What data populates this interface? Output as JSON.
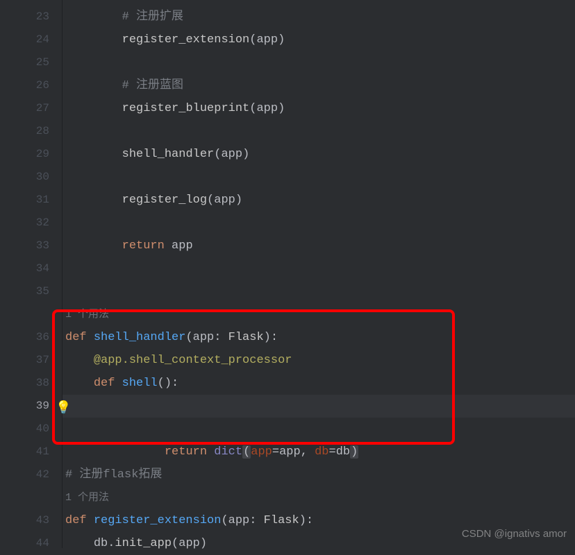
{
  "gutter": {
    "lines": [
      "23",
      "24",
      "25",
      "26",
      "27",
      "28",
      "29",
      "30",
      "31",
      "32",
      "33",
      "34",
      "35",
      "",
      "36",
      "37",
      "38",
      "39",
      "40",
      "41",
      "42",
      "",
      "43",
      "44"
    ],
    "current_index": 17
  },
  "hints": {
    "usage1": "1 个用法",
    "usage2": "1 个用法"
  },
  "code": {
    "l23": {
      "indent": "        ",
      "comment": "# 注册扩展"
    },
    "l24": {
      "indent": "        ",
      "fn": "register_extension",
      "arg": "app"
    },
    "l25": {
      "blank": true
    },
    "l26": {
      "indent": "        ",
      "comment": "# 注册蓝图"
    },
    "l27": {
      "indent": "        ",
      "fn": "register_blueprint",
      "arg": "app"
    },
    "l28": {
      "blank": true
    },
    "l29": {
      "indent": "        ",
      "fn": "shell_handler",
      "arg": "app"
    },
    "l30": {
      "blank": true
    },
    "l31": {
      "indent": "        ",
      "fn": "register_log",
      "arg": "app"
    },
    "l32": {
      "blank": true
    },
    "l33": {
      "indent": "        ",
      "kw": "return",
      "var": " app"
    },
    "l34": {
      "blank": true
    },
    "l35": {
      "blank": true
    },
    "l36": {
      "def": "def ",
      "name": "shell_handler",
      "sig_l": "(",
      "param": "app",
      "colon_t": ": ",
      "type": "Flask",
      "sig_r": "):"
    },
    "l37": {
      "indent": "    ",
      "dec_at": "@",
      "dec_obj": "app",
      "dec_dot": ".",
      "dec_fn": "shell_context_processor"
    },
    "l38": {
      "indent": "    ",
      "def": "def ",
      "name": "shell",
      "sig": "():"
    },
    "l39": {
      "indent": "        ",
      "kw": "return ",
      "builtin": "dict",
      "lp": "(",
      "k1": "app",
      "eq1": "=",
      "v1": "app",
      "comma": ", ",
      "k2": "db",
      "eq2": "=",
      "v2": "db",
      "rp": ")"
    },
    "l40": {
      "blank": true
    },
    "l41": {
      "blank": true
    },
    "l42": {
      "comment": "# 注册flask拓展"
    },
    "l43": {
      "def": "def ",
      "name": "register_extension",
      "sig_l": "(",
      "param": "app",
      "colon_t": ": ",
      "type": "Flask",
      "sig_r": "):"
    },
    "l44": {
      "indent": "    ",
      "obj": "db",
      "dot": ".",
      "fn": "init_app",
      "lp": "(",
      "arg": "app",
      "rp": ")"
    }
  },
  "lightbulb": "💡",
  "watermark": "CSDN @ignativs  amor"
}
